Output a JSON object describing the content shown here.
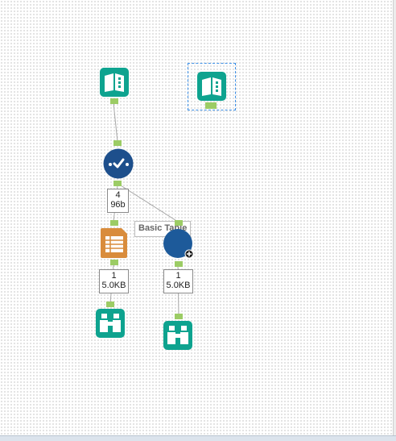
{
  "canvas": {
    "tooltip_text": "Basic Table",
    "connections": [
      {
        "records": "4",
        "size": "96b"
      },
      {
        "records": "1",
        "size": "5.0KB"
      },
      {
        "records": "1",
        "size": "5.0KB"
      }
    ]
  },
  "colors": {
    "teal": "#0ea38f",
    "navy": "#1d4f8c",
    "orange": "#d98c3c",
    "anchor_green": "#9ccc65"
  },
  "icons": [
    "input-data-icon",
    "input-data-icon",
    "select-icon",
    "table-icon",
    "layout-icon",
    "browse-icon",
    "browse-icon"
  ]
}
